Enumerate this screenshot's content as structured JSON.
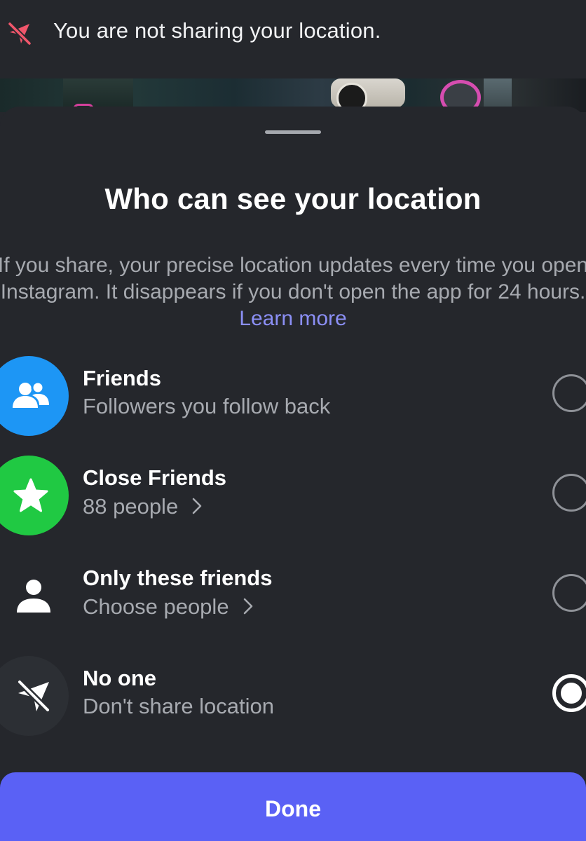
{
  "banner": {
    "icon": "location-off-icon",
    "text": "You are not sharing your location."
  },
  "sheet": {
    "title": "Who can see your location",
    "description": "If you share, your precise location updates every time you open Instagram. It disappears if you don't open the app for 24 hours.",
    "learn_more": "Learn more",
    "link_color": "#8b8ff5"
  },
  "options": [
    {
      "title": "Friends",
      "subtitle": "Followers you follow back",
      "icon": "friends-icon",
      "icon_bg": "#1d96f5",
      "selected": false
    },
    {
      "title": "Close Friends",
      "subtitle": "88 people",
      "icon": "star-icon",
      "icon_bg": "#20c943",
      "selected": false
    },
    {
      "title": "Only these friends",
      "subtitle": "Choose people",
      "icon": "person-icon",
      "selected": false
    },
    {
      "title": "No one",
      "subtitle": "Don't share location",
      "icon": "location-off-icon",
      "selected": true
    }
  ],
  "done_button": {
    "label": "Done",
    "color": "#5a61f5"
  }
}
